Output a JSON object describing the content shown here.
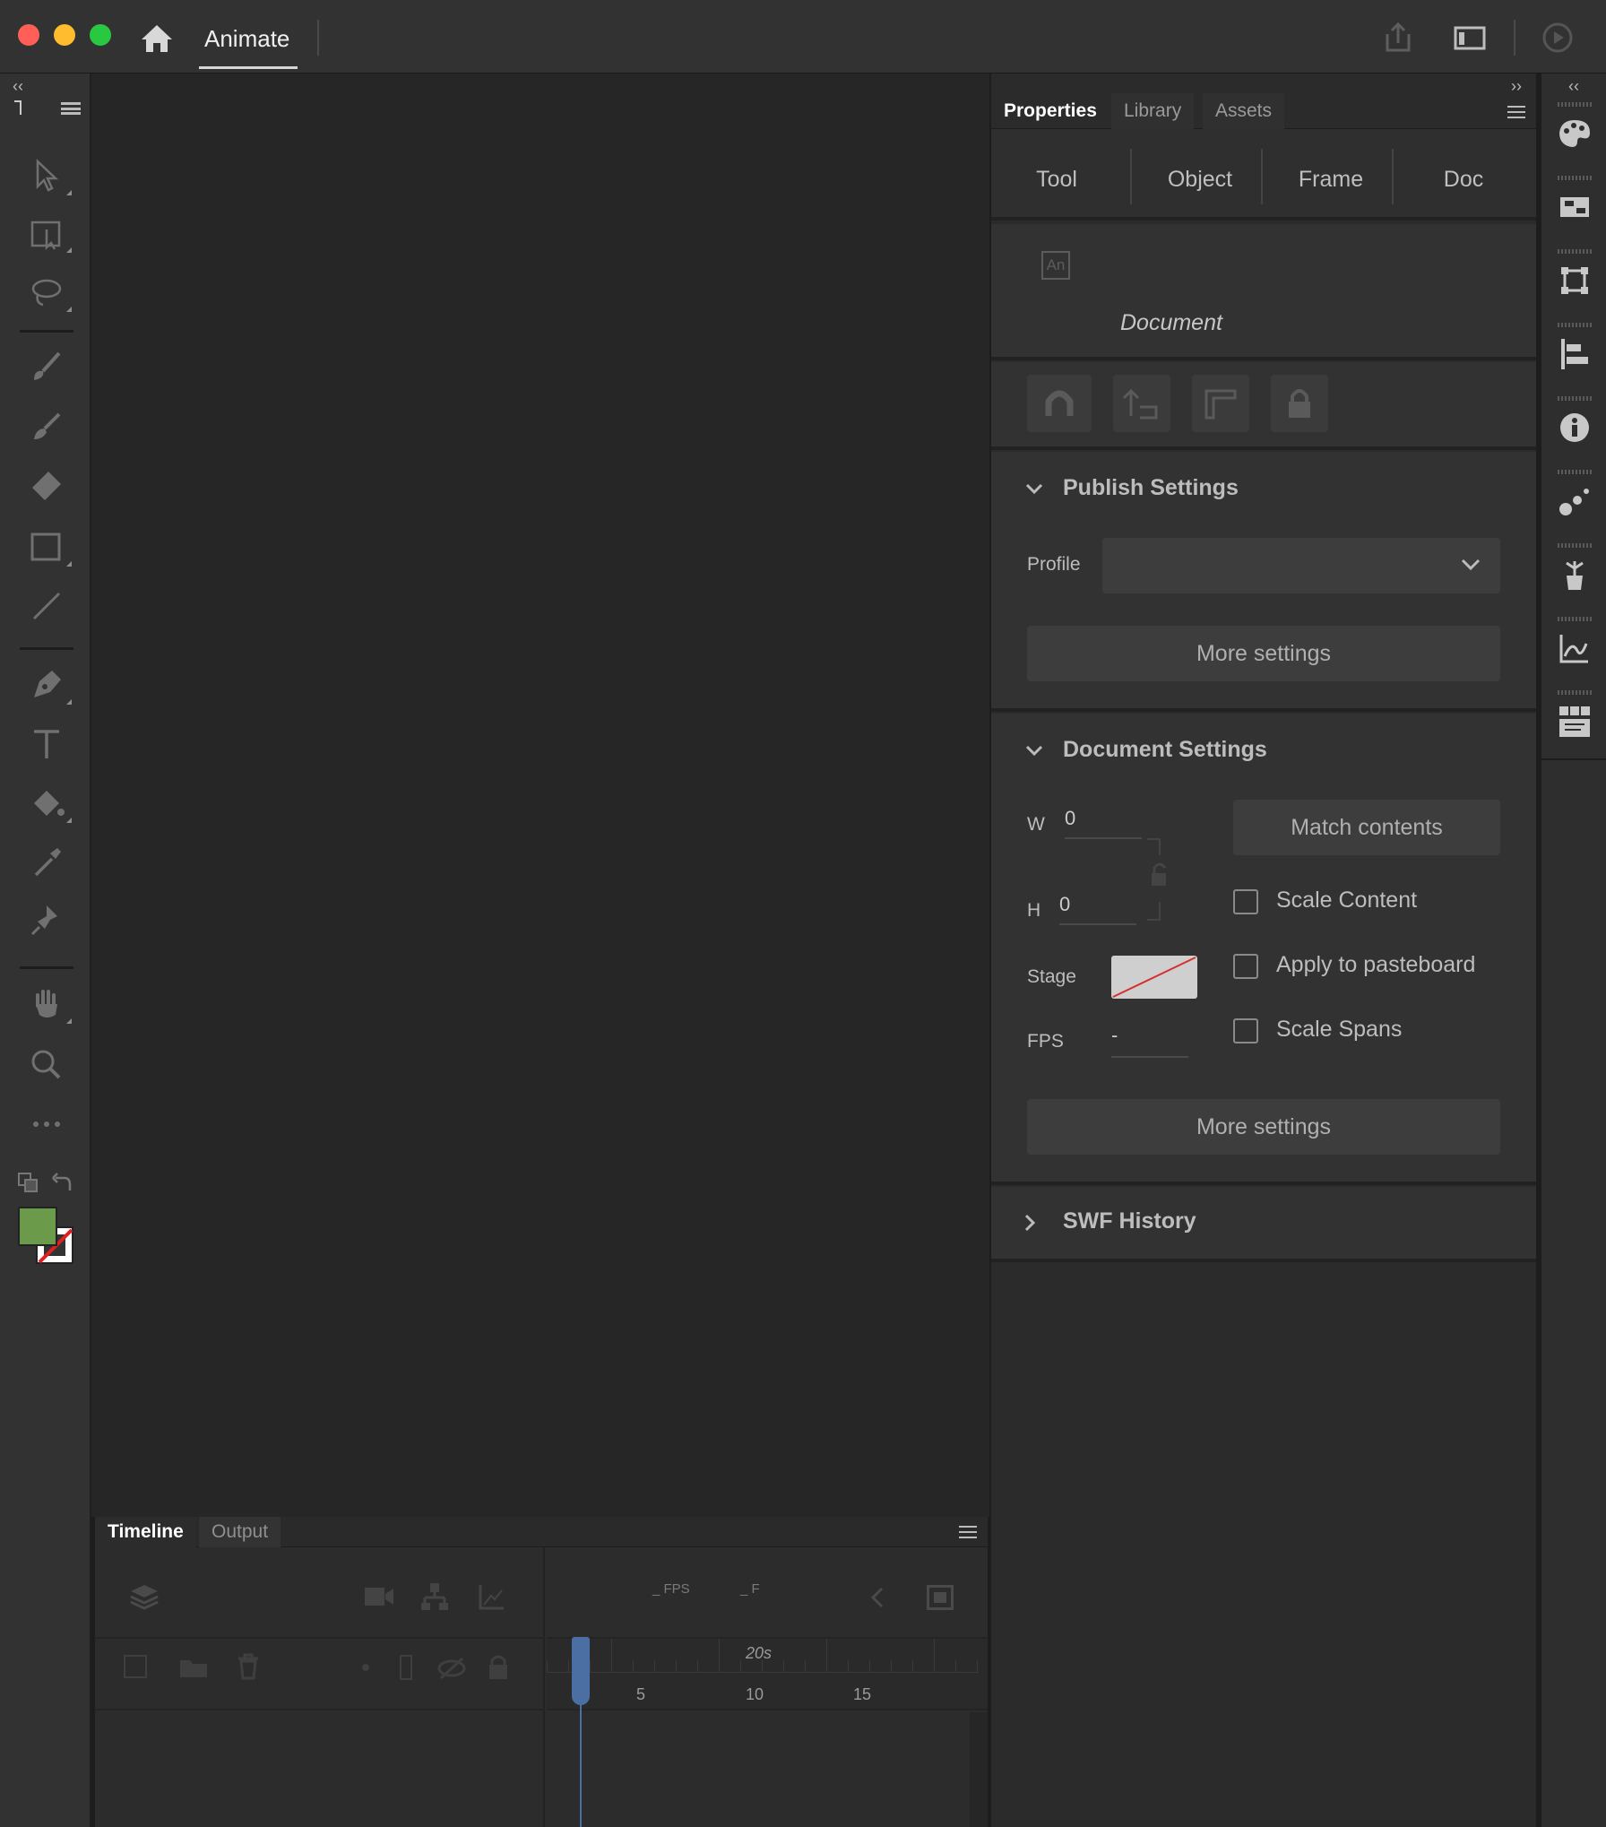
{
  "app": {
    "title": "Animate"
  },
  "properties_panel": {
    "tabs": [
      "Properties",
      "Library",
      "Assets"
    ],
    "subtabs": [
      "Tool",
      "Object",
      "Frame",
      "Doc"
    ],
    "object_type": "Document",
    "publish_settings": {
      "title": "Publish Settings",
      "profile_label": "Profile",
      "profile_value": "",
      "more_settings": "More settings"
    },
    "document_settings": {
      "title": "Document Settings",
      "w_label": "W",
      "w_value": "0",
      "h_label": "H",
      "h_value": "0",
      "match_contents": "Match contents",
      "scale_content": "Scale Content",
      "apply_to_pasteboard": "Apply to pasteboard",
      "scale_spans": "Scale Spans",
      "stage_label": "Stage",
      "fps_label": "FPS",
      "fps_value": "-",
      "more_settings": "More settings"
    },
    "swf_history": {
      "title": "SWF History"
    }
  },
  "timeline": {
    "tabs": [
      "Timeline",
      "Output"
    ],
    "fps_label": "FPS",
    "fps_value": "_",
    "frame_label": "F",
    "frame_value": "_",
    "time_marker": "20s",
    "ruler_numbers": [
      "5",
      "10",
      "15"
    ]
  },
  "colors": {
    "fill": "#6a9a4a",
    "accent_playhead": "#4b6fa3",
    "traffic_red": "#ff5f57",
    "traffic_yellow": "#febc2e",
    "traffic_green": "#28c840"
  },
  "icons": {
    "left_toolbar": [
      "selection-icon",
      "free-transform-icon",
      "lasso-icon",
      "paint-brush-icon",
      "brush-icon",
      "eraser-icon",
      "rectangle-icon",
      "line-icon",
      "pen-icon",
      "text-icon",
      "paint-bucket-icon",
      "eyedropper-icon",
      "pin-icon",
      "hand-icon",
      "zoom-icon",
      "more-tools-icon"
    ],
    "right_dock": [
      "color-icon",
      "swatches-icon",
      "transform-icon",
      "align-icon",
      "info-icon",
      "motion-presets-icon",
      "assets-icon",
      "graph-icon",
      "code-snippets-icon"
    ]
  }
}
